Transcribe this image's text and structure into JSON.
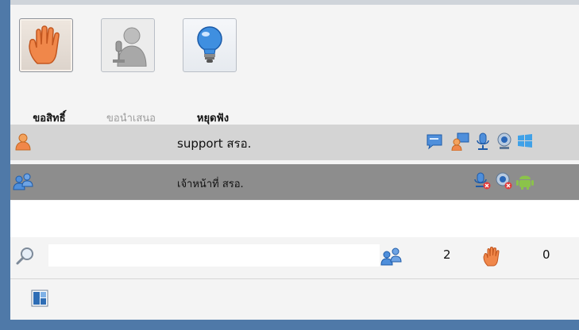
{
  "toolbar": {
    "request_right_label": "ขอสิทธิ์",
    "present_label": "ขอนำเสนอ",
    "stop_listen_label": "หยุดฟัง"
  },
  "participants": [
    {
      "name": "support สรอ."
    },
    {
      "name": "เจ้าหน้าที่ สรอ."
    }
  ],
  "search": {
    "value": "",
    "placeholder": ""
  },
  "counts": {
    "users": "2",
    "raised_hands": "0"
  },
  "colors": {
    "frame_blue": "#4f79a8",
    "row_selected": "#8d8d8d",
    "row_normal": "#d4d4d4",
    "hand_orange": "#f0874a"
  }
}
